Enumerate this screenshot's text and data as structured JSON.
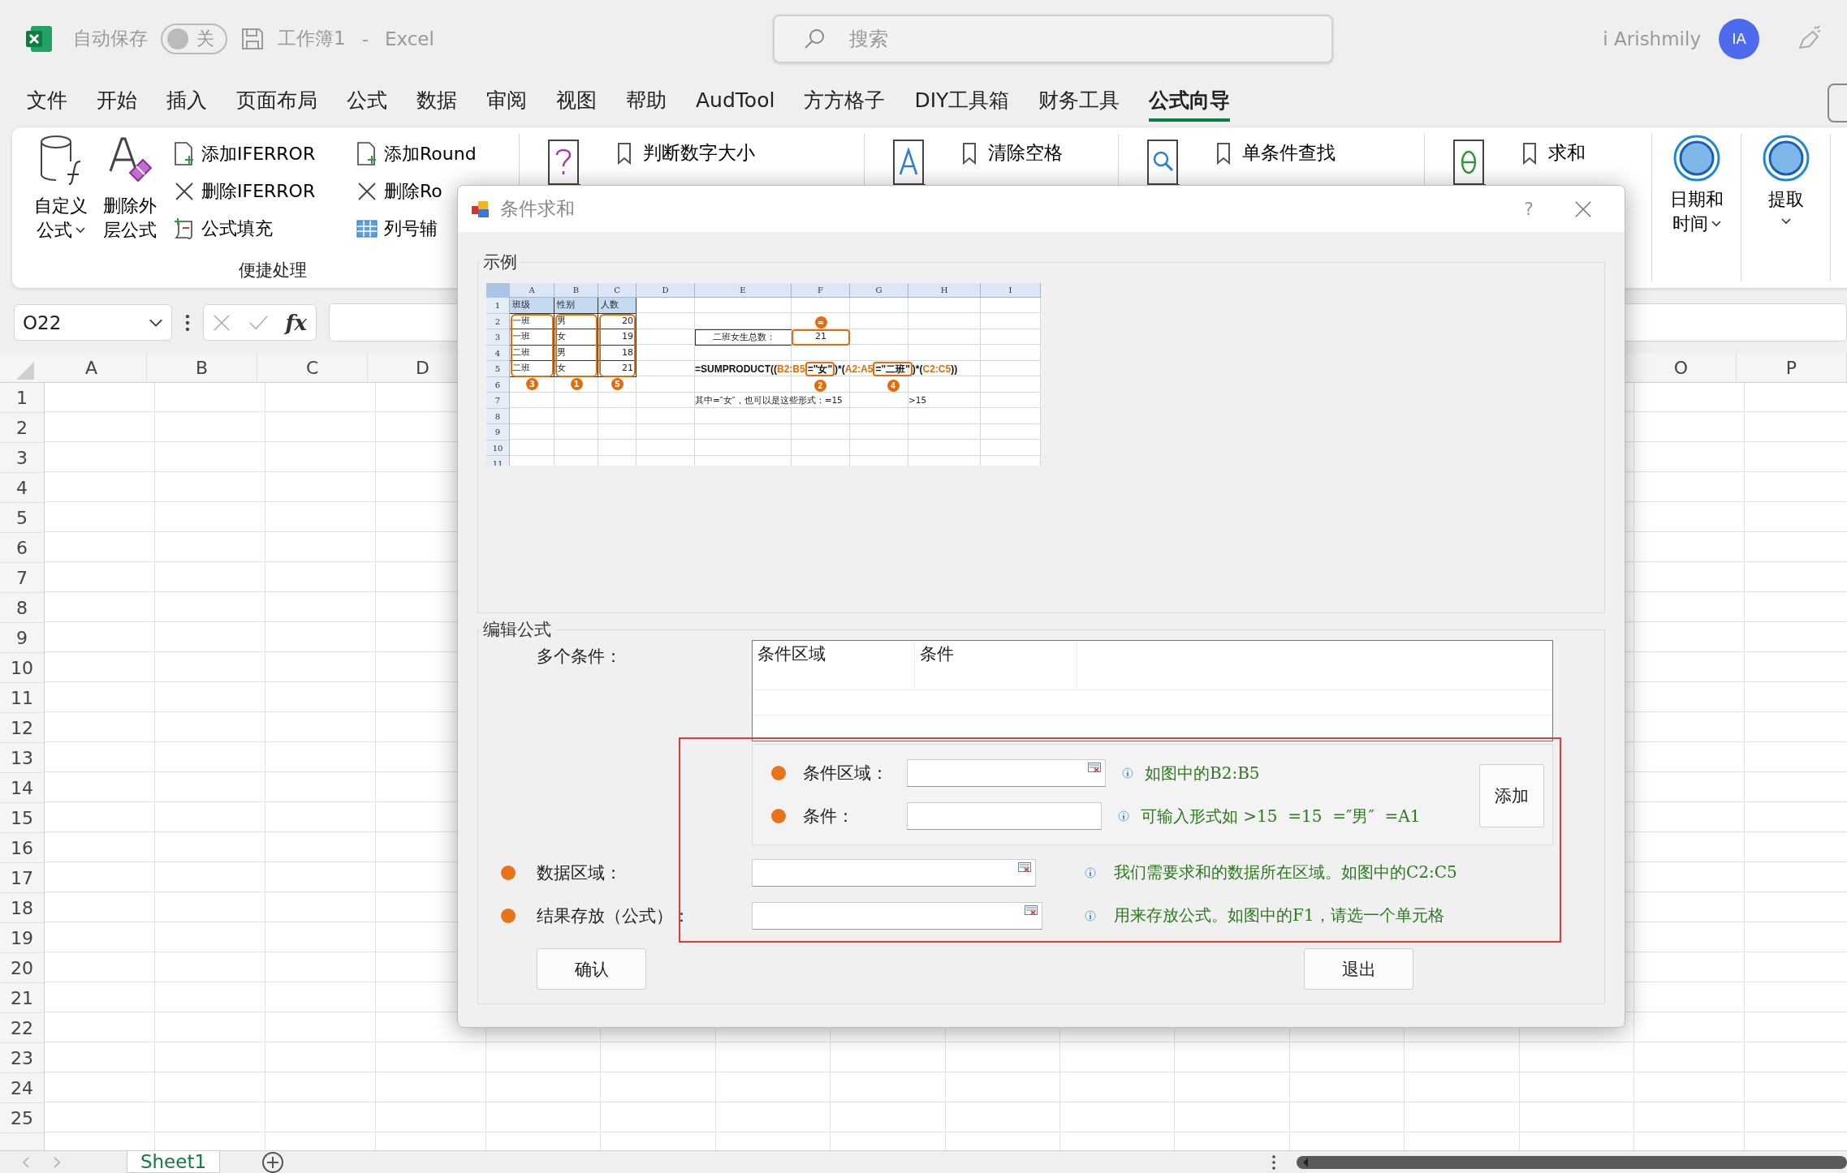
{
  "title_bar": {
    "autosave_label": "自动保存",
    "autosave": {
      "label": "关",
      "on": false
    },
    "document": "工作簿1",
    "separator": "-",
    "app": "Excel",
    "search": {
      "placeholder": "搜索"
    },
    "user": "i Arishmily",
    "avatar": "IA"
  },
  "tabs": [
    {
      "label": "文件",
      "selected": false
    },
    {
      "label": "开始",
      "selected": false
    },
    {
      "label": "插入",
      "selected": false
    },
    {
      "label": "页面布局",
      "selected": false
    },
    {
      "label": "公式",
      "selected": false
    },
    {
      "label": "数据",
      "selected": false
    },
    {
      "label": "审阅",
      "selected": false
    },
    {
      "label": "视图",
      "selected": false
    },
    {
      "label": "帮助",
      "selected": false
    },
    {
      "label": "AudTool",
      "selected": false
    },
    {
      "label": "方方格子",
      "selected": false
    },
    {
      "label": "DIY工具箱",
      "selected": false
    },
    {
      "label": "财务工具",
      "selected": false
    },
    {
      "label": "公式向导",
      "selected": true
    }
  ],
  "ribbon": {
    "large_buttons": [
      {
        "kind": "custom-formula",
        "lines": [
          "自定义",
          "公式"
        ],
        "dropdown": true
      },
      {
        "kind": "remove-outer",
        "lines": [
          "删除外",
          "层公式"
        ],
        "dropdown": false
      }
    ],
    "small_buttons": [
      {
        "kind": "add",
        "label": "添加IFERROR"
      },
      {
        "kind": "delete",
        "label": "删除IFERROR"
      },
      {
        "kind": "fill",
        "label": "公式填充"
      },
      {
        "kind": "add",
        "label": "添加Round"
      },
      {
        "kind": "delete",
        "label": "删除Ro"
      },
      {
        "kind": "grid",
        "label": "列号辅"
      }
    ],
    "group_label": "便捷处理",
    "wizard_groups": [
      {
        "kind": "question",
        "item": "判断数字大小"
      },
      {
        "kind": "text",
        "item": "清除空格"
      },
      {
        "kind": "search",
        "item": "单条件查找"
      },
      {
        "kind": "theta",
        "item": "求和"
      }
    ],
    "circle_buttons": [
      {
        "lines": [
          "日期和",
          "时间"
        ],
        "dropdown": true
      },
      {
        "lines": [
          "提取"
        ],
        "dropdown": true
      }
    ]
  },
  "formula_bar": {
    "name_box": "O22",
    "function_label": "fx"
  },
  "sheet": {
    "columns": [
      "A",
      "B",
      "C",
      "D",
      "O",
      "P"
    ],
    "rows": [
      "1",
      "2",
      "3",
      "4",
      "5",
      "6",
      "7",
      "8",
      "9",
      "10",
      "11",
      "12",
      "13",
      "14",
      "15",
      "16",
      "17",
      "18",
      "19",
      "20",
      "21",
      "22",
      "23",
      "24",
      "25"
    ]
  },
  "sheet_tabs": [
    {
      "label": "Sheet1",
      "selected": true
    }
  ],
  "dialog": {
    "title": "条件求和",
    "help": "?",
    "example": {
      "legend": "示例",
      "columns": [
        "A",
        "B",
        "C",
        "D",
        "E",
        "F",
        "G",
        "H",
        "I"
      ],
      "row_numbers": [
        "1",
        "2",
        "3",
        "4",
        "5",
        "6",
        "7",
        "8",
        "9",
        "10",
        "11"
      ],
      "table": [
        [
          "班级",
          "性别",
          "人数"
        ],
        [
          "一班",
          "男",
          "20"
        ],
        [
          "一班",
          "女",
          "19"
        ],
        [
          "二班",
          "男",
          "18"
        ],
        [
          "二班",
          "女",
          "21"
        ]
      ],
      "column_markers": [
        "3",
        "1",
        "5"
      ],
      "total": {
        "label": "二班女生总数：",
        "value": "21",
        "marker": "="
      },
      "formula": [
        {
          "text": "=SUMPRODUCT((",
          "kind": "plain"
        },
        {
          "text": "B2:B5",
          "kind": "ref"
        },
        {
          "text": "=\"女\"",
          "kind": "boxed",
          "marker": "2"
        },
        {
          "text": ")*(",
          "kind": "plain"
        },
        {
          "text": "A2:A5",
          "kind": "ref"
        },
        {
          "text": "=\"二班\"",
          "kind": "boxed",
          "marker": "4"
        },
        {
          "text": ")*(",
          "kind": "plain"
        },
        {
          "text": "C2:C5",
          "kind": "ref"
        },
        {
          "text": "))",
          "kind": "plain"
        }
      ],
      "note": "其中=″女″，也可以是这些形式：=15",
      "note_extra": ">15"
    },
    "edit": {
      "legend": "编辑公式",
      "multi_label": "多个条件：",
      "list_columns": [
        "条件区域",
        "条件"
      ],
      "condition_range": {
        "label": "条件区域：",
        "hint": "如图中的B2:B5"
      },
      "condition": {
        "label": "条件：",
        "hint": "可输入形式如 >15  =15  =″男″  =A1"
      },
      "add_button": "添加",
      "data_range": {
        "label": "数据区域：",
        "hint": "我们需要求和的数据所在区域。如图中的C2:C5"
      },
      "result": {
        "label": "结果存放（公式）：",
        "hint": "用来存放公式。如图中的F1，请选一个单元格"
      },
      "confirm_button": "确认",
      "exit_button": "退出"
    }
  }
}
